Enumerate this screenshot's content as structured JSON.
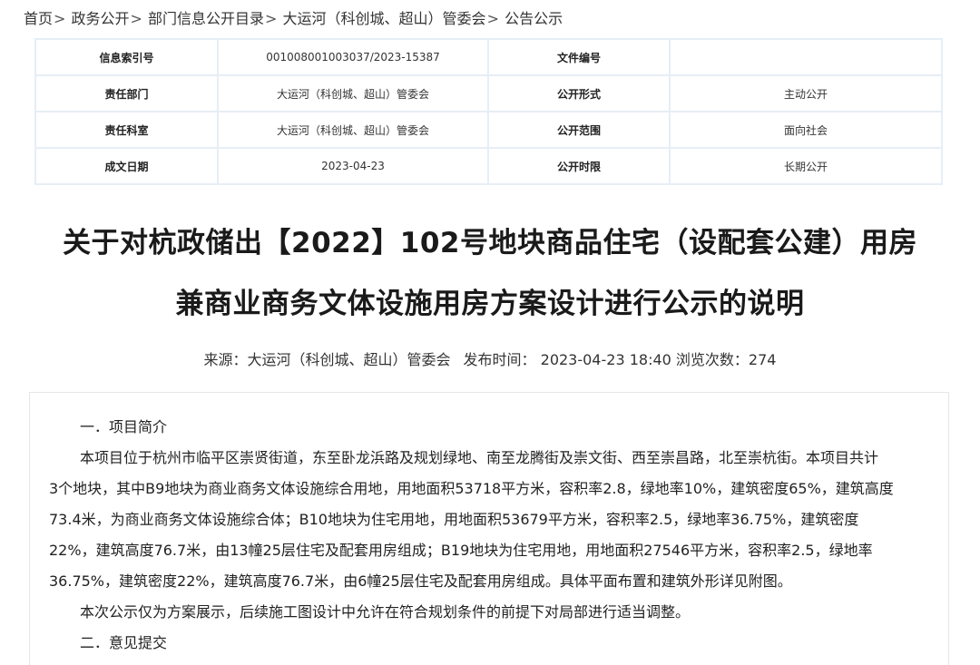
{
  "breadcrumb": [
    "首页",
    "政务公开",
    "部门信息公开目录",
    "大运河（科创城、超山）管委会",
    "公告公示"
  ],
  "breadcrumb_sep": ">",
  "meta": {
    "index_no_label": "信息索引号",
    "index_no_value": "001008001003037/2023-15387",
    "doc_no_label": "文件编号",
    "doc_no_value": "",
    "dept_label": "责任部门",
    "dept_value": "大运河（科创城、超山）管委会",
    "form_label": "公开形式",
    "form_value": "主动公开",
    "section_label": "责任科室",
    "section_value": "大运河（科创城、超山）管委会",
    "scope_label": "公开范围",
    "scope_value": "面向社会",
    "date_label": "成文日期",
    "date_value": "2023-04-23",
    "period_label": "公开时限",
    "period_value": "长期公开"
  },
  "article": {
    "title_line1": "关于对杭政储出【2022】102号地块商品住宅（设配套公建）用房",
    "title_line2": "兼商业商务文体设施用房方案设计进行公示的说明",
    "source": "来源：大运河（科创城、超山）管委会",
    "publish": "发布时间：  2023-04-23 18:40 浏览次数：274",
    "heading1": "一．项目简介",
    "para1_lines": [
      "本项目位于杭州市临平区崇贤街道，东至卧龙浜路及规划绿地、南至龙腾街及崇文街、西至崇昌路，北至崇杭街。本项目共计",
      "3个地块，其中B9地块为商业商务文体设施综合用地，用地面积53718平方米，容积率2.8，绿地率10%，建筑密度65%，建筑高度",
      "73.4米，为商业商务文体设施综合体；B10地块为住宅用地，用地面积53679平方米，容积率2.5，绿地率36.75%，建筑密度",
      "22%，建筑高度76.7米，由13幢25层住宅及配套用房组成；B19地块为住宅用地，用地面积27546平方米，容积率2.5，绿地率",
      "36.75%，建筑密度22%，建筑高度76.7米，由6幢25层住宅及配套用房组成。具体平面布置和建筑外形详见附图。"
    ],
    "para2": "本次公示仅为方案展示，后续施工图设计中允许在符合规划条件的前提下对局部进行适当调整。",
    "heading2": "二．意见提交"
  }
}
